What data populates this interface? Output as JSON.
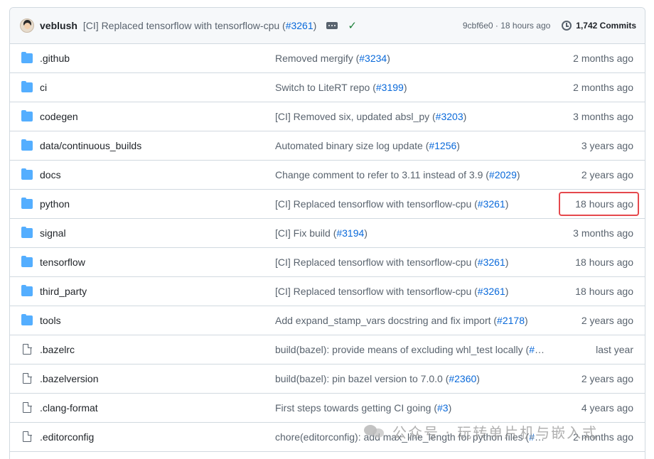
{
  "commit": {
    "author": "veblush",
    "message": "[CI] Replaced tensorflow with tensorflow-cpu (",
    "pr": "#3261",
    "message_end": ")",
    "sha": "9cbf6e0",
    "separator": " · ",
    "time": "18 hours ago",
    "commits_label": "1,742 Commits",
    "icons": {
      "avatar": "avatar",
      "more": "ellipsis-icon",
      "status": "check-icon",
      "history": "clock-icon"
    },
    "status_color": "#1a7f37"
  },
  "rows": [
    {
      "type": "folder",
      "name": ".github",
      "msg": "Removed mergify (",
      "pr": "#3234",
      "msg_end": ")",
      "age": "2 months ago"
    },
    {
      "type": "folder",
      "name": "ci",
      "msg": "Switch to LiteRT repo (",
      "pr": "#3199",
      "msg_end": ")",
      "age": "2 months ago"
    },
    {
      "type": "folder",
      "name": "codegen",
      "msg": "[CI] Removed six, updated absl_py (",
      "pr": "#3203",
      "msg_end": ")",
      "age": "3 months ago"
    },
    {
      "type": "folder",
      "name": "data/continuous_builds",
      "msg": "Automated binary size log update (",
      "pr": "#1256",
      "msg_end": ")",
      "age": "3 years ago"
    },
    {
      "type": "folder",
      "name": "docs",
      "msg": "Change comment to refer to 3.11 instead of 3.9 (",
      "pr": "#2029",
      "msg_end": ")",
      "age": "2 years ago"
    },
    {
      "type": "folder",
      "name": "python",
      "msg": "[CI] Replaced tensorflow with tensorflow-cpu (",
      "pr": "#3261",
      "msg_end": ")",
      "age": "18 hours ago"
    },
    {
      "type": "folder",
      "name": "signal",
      "msg": "[CI] Fix build (",
      "pr": "#3194",
      "msg_end": ")",
      "age": "3 months ago"
    },
    {
      "type": "folder",
      "name": "tensorflow",
      "msg": "[CI] Replaced tensorflow with tensorflow-cpu (",
      "pr": "#3261",
      "msg_end": ")",
      "age": "18 hours ago"
    },
    {
      "type": "folder",
      "name": "third_party",
      "msg": "[CI] Replaced tensorflow with tensorflow-cpu (",
      "pr": "#3261",
      "msg_end": ")",
      "age": "18 hours ago"
    },
    {
      "type": "folder",
      "name": "tools",
      "msg": "Add expand_stamp_vars docstring and fix import (",
      "pr": "#2178",
      "msg_end": ")",
      "age": "2 years ago"
    },
    {
      "type": "file",
      "name": ".bazelrc",
      "msg": "build(bazel): provide means of excluding whl_test locally (",
      "pr": "#2...",
      "msg_end": "",
      "age": "last year"
    },
    {
      "type": "file",
      "name": ".bazelversion",
      "msg": "build(bazel): pin bazel version to 7.0.0 (",
      "pr": "#2360",
      "msg_end": ")",
      "age": "2 years ago"
    },
    {
      "type": "file",
      "name": ".clang-format",
      "msg": "First steps towards getting CI going (",
      "pr": "#3",
      "msg_end": ")",
      "age": "4 years ago"
    },
    {
      "type": "file",
      "name": ".editorconfig",
      "msg": "chore(editorconfig): add max_line_length for python files (",
      "pr": "#8...",
      "msg_end": "",
      "age": "2 months ago"
    }
  ],
  "watermark": {
    "text": "公众号 · 玩转单片机与嵌入式",
    "icon": "wechat-logo"
  },
  "colors": {
    "folder": "#54aeff",
    "link": "#0969da",
    "highlight": "#e5484d"
  }
}
